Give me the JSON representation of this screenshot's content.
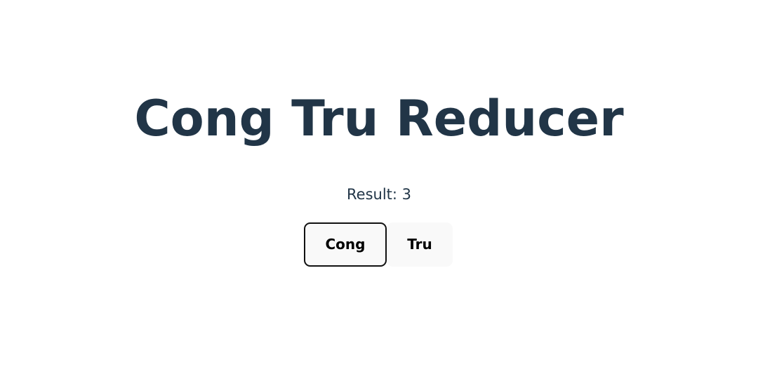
{
  "app": {
    "title": "Cong Tru Reducer"
  },
  "result": {
    "label": "Result: 3"
  },
  "buttons": {
    "cong_label": "Cong",
    "tru_label": "Tru"
  }
}
